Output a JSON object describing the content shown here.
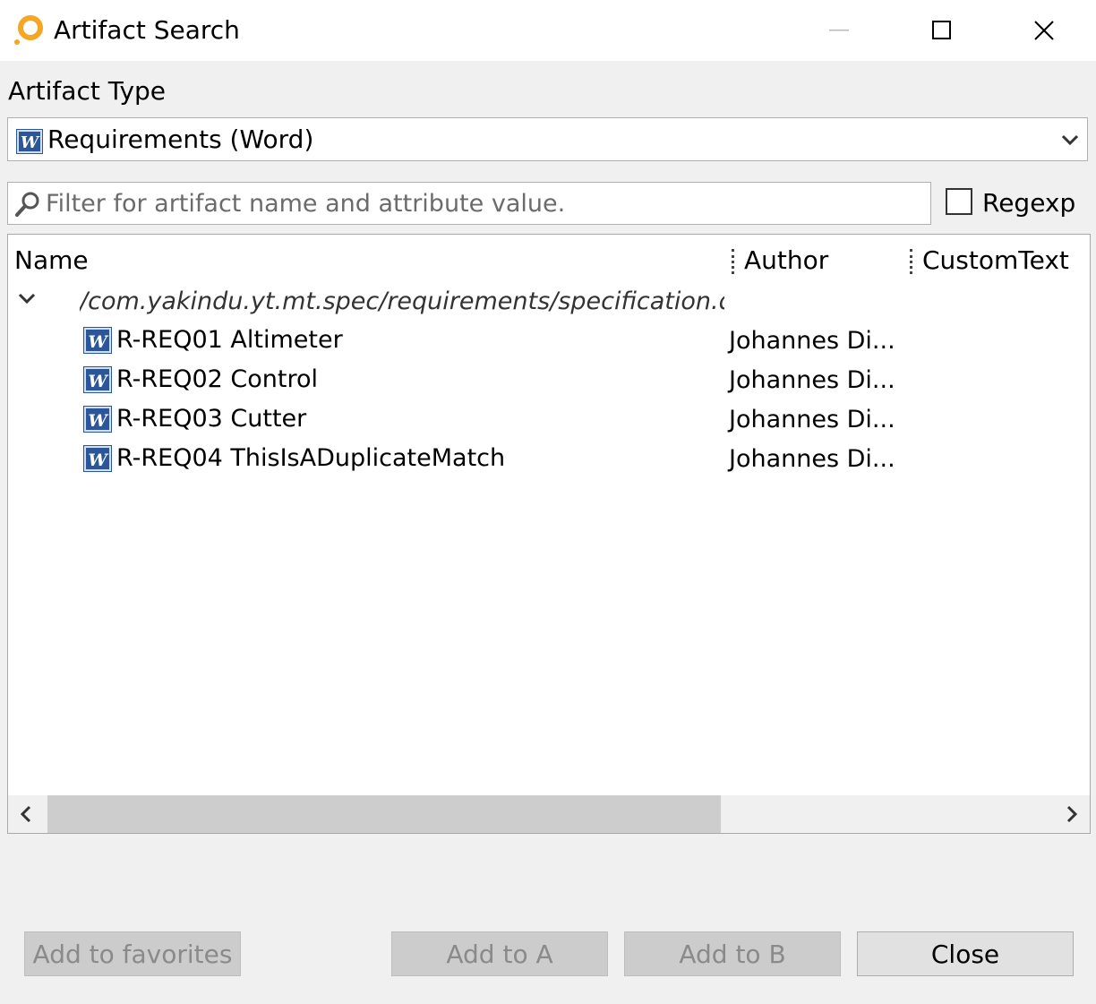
{
  "window": {
    "title": "Artifact Search"
  },
  "artifact_type": {
    "label": "Artifact Type",
    "selected": "Requirements (Word)"
  },
  "filter": {
    "placeholder": "Filter for artifact name and attribute value.",
    "value": ""
  },
  "regexp": {
    "label": "Regexp",
    "checked": false
  },
  "table": {
    "columns": [
      "Name",
      "Author",
      "CustomText"
    ],
    "group_path": "/com.yakindu.yt.mt.spec/requirements/specification.docx",
    "items": [
      {
        "name": "R-REQ01 Altimeter",
        "author": "Johannes Di..."
      },
      {
        "name": "R-REQ02 Control",
        "author": "Johannes Di..."
      },
      {
        "name": "R-REQ03 Cutter",
        "author": "Johannes Di..."
      },
      {
        "name": "R-REQ04 ThisIsADuplicateMatch",
        "author": "Johannes Di..."
      }
    ]
  },
  "buttons": {
    "add_favorites": "Add to favorites",
    "add_a": "Add to A",
    "add_b": "Add to B",
    "close": "Close"
  },
  "icons": [
    "app-logo-icon",
    "minimize-icon",
    "maximize-icon",
    "close-icon",
    "word-icon",
    "chevron-down-icon",
    "search-icon",
    "scroll-left-icon",
    "scroll-right-icon"
  ],
  "colors": {
    "app_icon": "#f5a623",
    "word_icon": "#2b579a"
  }
}
